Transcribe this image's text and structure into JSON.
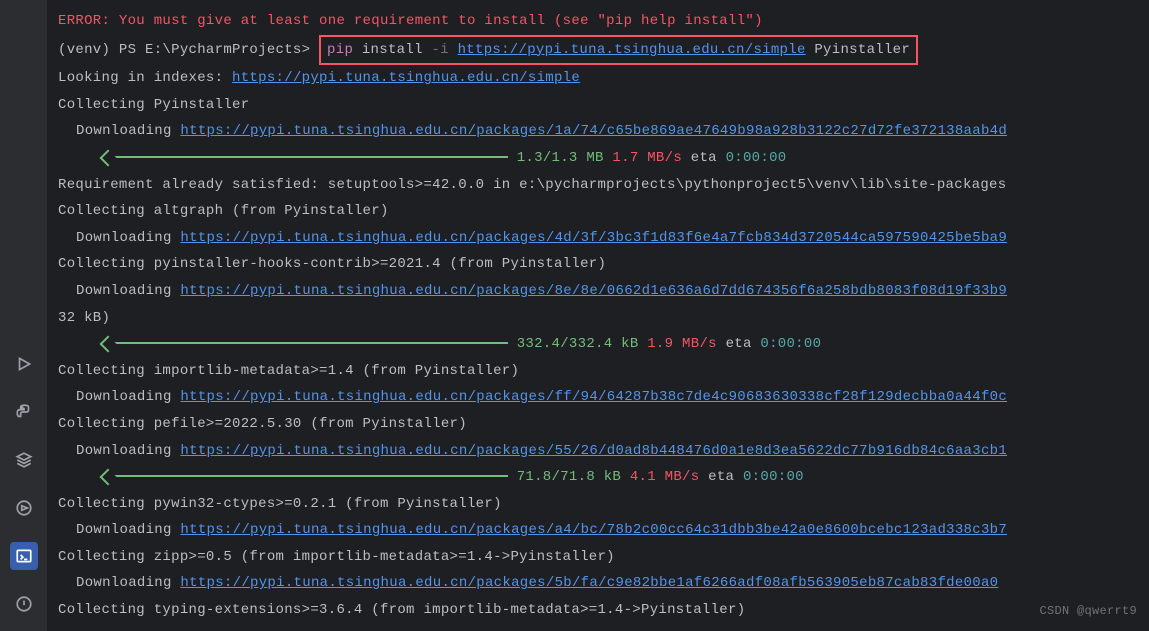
{
  "sidebar": {
    "icons": [
      "run",
      "python",
      "layers",
      "services",
      "terminal",
      "problems"
    ]
  },
  "terminal": {
    "error": "ERROR: You must give at least one requirement to install (see \"pip help install\")",
    "prompt": "(venv) PS E:\\PycharmProjects>",
    "cmd_pip": "pip",
    "cmd_install": "install",
    "cmd_flag": "-i",
    "cmd_url": "https://pypi.tuna.tsinghua.edu.cn/simple",
    "cmd_pkg": "Pyinstaller",
    "looking": "Looking in indexes: ",
    "idx_url": "https://pypi.tuna.tsinghua.edu.cn/simple",
    "collect1": "Collecting Pyinstaller",
    "dl_label": "Downloading ",
    "dl1": "https://pypi.tuna.tsinghua.edu.cn/packages/1a/74/c65be869ae47649b98a928b3122c27d72fe372138aab4d",
    "p1_size": "1.3/1.3 MB",
    "p1_speed": "1.7 MB/s",
    "p1_eta": "eta ",
    "p1_time": "0:00:00",
    "req_sat": "Requirement already satisfied: setuptools>=42.0.0 in e:\\pycharmprojects\\pythonproject5\\venv\\lib\\site-packages",
    "collect2": "Collecting altgraph (from Pyinstaller)",
    "dl2": "https://pypi.tuna.tsinghua.edu.cn/packages/4d/3f/3bc3f1d83f6e4a7fcb834d3720544ca597590425be5ba9",
    "collect3": "Collecting pyinstaller-hooks-contrib>=2021.4 (from Pyinstaller)",
    "dl3": "https://pypi.tuna.tsinghua.edu.cn/packages/8e/8e/0662d1e636a6d7dd674356f6a258bdb8083f08d19f33b9",
    "dl3_size": "32 kB)",
    "p2_size": "332.4/332.4 kB",
    "p2_speed": "1.9 MB/s",
    "p2_time": "0:00:00",
    "collect4": "Collecting importlib-metadata>=1.4 (from Pyinstaller)",
    "dl4": "https://pypi.tuna.tsinghua.edu.cn/packages/ff/94/64287b38c7de4c90683630338cf28f129decbba0a44f0c",
    "collect5": "Collecting pefile>=2022.5.30 (from Pyinstaller)",
    "dl5": "https://pypi.tuna.tsinghua.edu.cn/packages/55/26/d0ad8b448476d0a1e8d3ea5622dc77b916db84c6aa3cb1",
    "p3_size": "71.8/71.8 kB",
    "p3_speed": "4.1 MB/s",
    "p3_time": "0:00:00",
    "collect6": "Collecting pywin32-ctypes>=0.2.1 (from Pyinstaller)",
    "dl6": "https://pypi.tuna.tsinghua.edu.cn/packages/a4/bc/78b2c00cc64c31dbb3be42a0e8600bcebc123ad338c3b7",
    "collect7": "Collecting zipp>=0.5 (from importlib-metadata>=1.4->Pyinstaller)",
    "dl7": "https://pypi.tuna.tsinghua.edu.cn/packages/5b/fa/c9e82bbe1af6266adf08afb563905eb87cab83fde00a0",
    "collect8": "Collecting typing-extensions>=3.6.4 (from importlib-metadata>=1.4->Pyinstaller)"
  },
  "watermark": "CSDN @qwerrt9"
}
